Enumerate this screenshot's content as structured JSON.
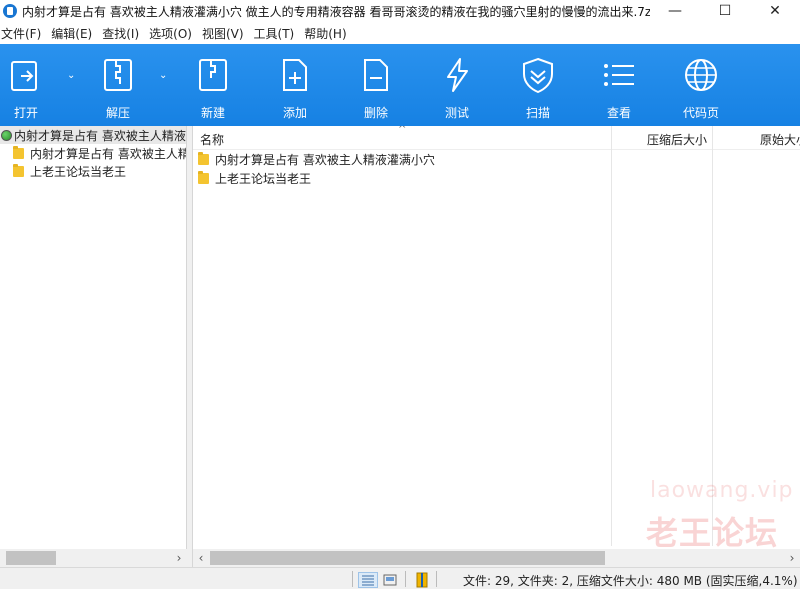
{
  "window": {
    "title": "内射才算是占有 喜欢被主人精液灌满小穴 做主人的专用精液容器 看哥哥滚烫的精液在我的骚穴里射的慢慢的流出来.7z...",
    "minimize": "—",
    "maximize": "☐",
    "close": "✕"
  },
  "menu": [
    "文件(F)",
    "编辑(E)",
    "查找(I)",
    "选项(O)",
    "视图(V)",
    "工具(T)",
    "帮助(H)"
  ],
  "toolbar": {
    "open": "打开",
    "extract": "解压",
    "new": "新建",
    "add": "添加",
    "delete": "删除",
    "test": "测试",
    "scan": "扫描",
    "view": "查看",
    "codepage": "代码页",
    "dropdown_glyph": "⌄"
  },
  "tree": {
    "root": "内射才算是占有 喜欢被主人精液灌满小穴",
    "children": [
      "内射才算是占有 喜欢被主人精液灌满小穴",
      "上老王论坛当老王"
    ]
  },
  "columns": {
    "name": "名称",
    "sort_glyph": "^",
    "compressed_size": "压缩后大小",
    "original_size": "原始大小"
  },
  "files": [
    "内射才算是占有 喜欢被主人精液灌满小穴",
    "上老王论坛当老王"
  ],
  "scroll": {
    "left_arrow": "‹",
    "right_arrow": "›"
  },
  "status": {
    "text": "文件: 29, 文件夹: 2, 压缩文件大小: 480 MB (固实压缩,4.1%)"
  },
  "watermark": {
    "text": "老王论坛",
    "url": "laowang.vip"
  },
  "colors": {
    "toolbar": "#1a88e8",
    "folder": "#f4c430"
  }
}
